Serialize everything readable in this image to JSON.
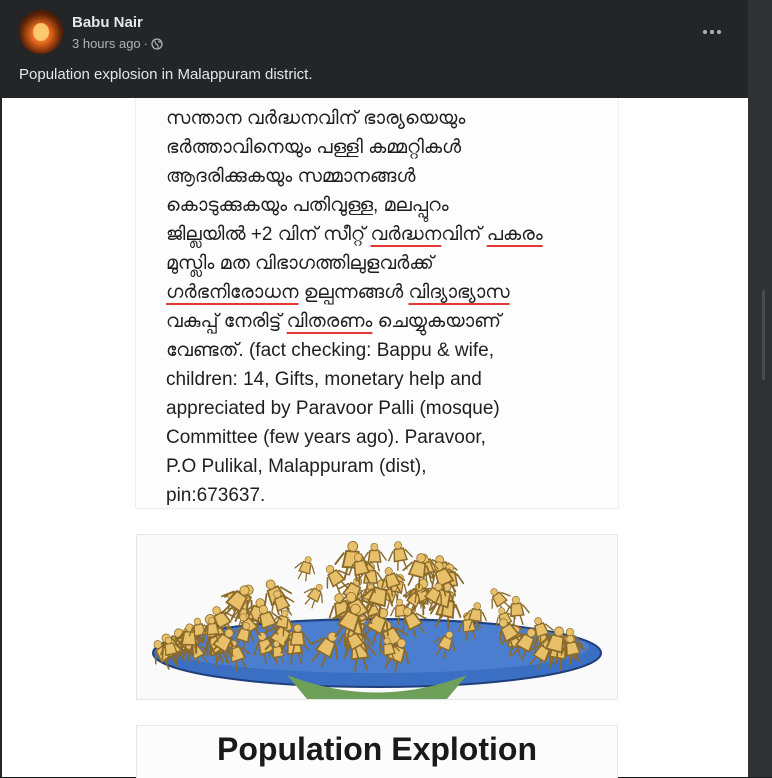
{
  "post": {
    "author": "Babu Nair",
    "time": "3 hours ago",
    "separator": "·",
    "caption": "Population explosion in Malappuram district."
  },
  "icons": {
    "privacy": "globe-icon",
    "more": "more-options-icon"
  },
  "image_text": {
    "lines": [
      "സന്താന വർദ്ധനവിന് ഭാര്യയെയും",
      "ഭർത്താവിനെയും പള്ളി കമ്മറ്റികൾ",
      "ആദരിക്കുകയും സമ്മാനങ്ങൾ",
      "കൊടുക്കുകയും പതിവുള്ള, മലപ്പുറം",
      "ജില്ലയിൽ +2 വിന് സീറ്റ് ",
      "വർദ്ധന",
      "വിന് ",
      "പകരം",
      "മുസ്ലിം മത വിഭാഗത്തിലുളവർക്ക്",
      "ഗർഭനിരോധന",
      " ഉല്പന്നങ്ങൾ ",
      "വിദ്യാഭ്യാസ",
      "വകുപ്പ് നേരിട്ട് ",
      "വിതരണം",
      " ചെയ്യുകയാണ്",
      "വേണ്ടത്. (fact checking: Bappu & wife,",
      "children: 14, Gifts, monetary help and",
      "appreciated by Paravoor Palli (mosque)",
      "Committee (few years ago). Paravoor,",
      "P.O Pulikal, Malappuram (dist),",
      "pin:673637."
    ],
    "bottom_title": "Population Explotion"
  },
  "colors": {
    "page_bg": "#18191a",
    "card_bg": "#242526",
    "primary_text": "#e4e6eb",
    "secondary_text": "#b0b3b8",
    "underline": "#e53935",
    "figure": "#e8c06a",
    "bowl": "#3b6fc4"
  }
}
